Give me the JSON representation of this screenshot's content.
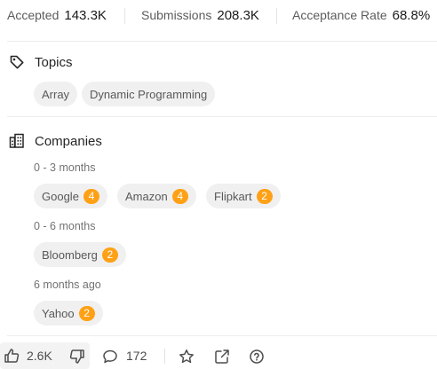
{
  "stats": {
    "accepted_label": "Accepted",
    "accepted_value": "143.3K",
    "submissions_label": "Submissions",
    "submissions_value": "208.3K",
    "acceptance_rate_label": "Acceptance Rate",
    "acceptance_rate_value": "68.8%"
  },
  "topics": {
    "title": "Topics",
    "icon": "tag-icon",
    "tags": [
      "Array",
      "Dynamic Programming"
    ]
  },
  "companies": {
    "title": "Companies",
    "icon": "building-icon",
    "groups": [
      {
        "period": "0 - 3 months",
        "items": [
          {
            "name": "Google",
            "count": "4"
          },
          {
            "name": "Amazon",
            "count": "4"
          },
          {
            "name": "Flipkart",
            "count": "2"
          }
        ]
      },
      {
        "period": "0 - 6 months",
        "items": [
          {
            "name": "Bloomberg",
            "count": "2"
          }
        ]
      },
      {
        "period": "6 months ago",
        "items": [
          {
            "name": "Yahoo",
            "count": "2"
          }
        ]
      }
    ]
  },
  "actions": {
    "likes": "2.6K",
    "comments": "172",
    "icons": [
      "thumbs-up-icon",
      "thumbs-down-icon",
      "comment-icon",
      "star-icon",
      "share-icon",
      "help-icon"
    ]
  },
  "colors": {
    "badge": "#ffa116",
    "chip_bg": "#f0f0f0"
  }
}
